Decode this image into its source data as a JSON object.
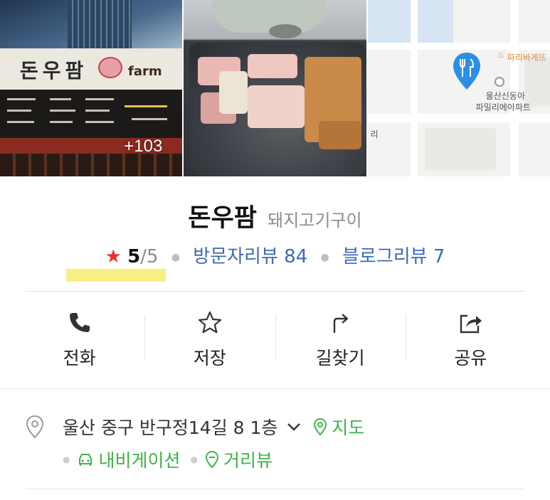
{
  "photos": {
    "storefront_sign": "돈우팜",
    "storefront_sign_suffix": "farm",
    "more_count": "+103",
    "map_labels": {
      "bakery": "파리바게뜨",
      "apartment_line1": "울산신동아",
      "apartment_line2": "파밀리에아파트",
      "edge": "리"
    }
  },
  "place": {
    "name": "돈우팜",
    "category": "돼지고기구이",
    "rating": "5",
    "rating_max": "/5",
    "visitor_reviews": "방문자리뷰 84",
    "blog_reviews": "블로그리뷰 7"
  },
  "actions": [
    {
      "label": "전화",
      "icon": "phone-icon"
    },
    {
      "label": "저장",
      "icon": "star-outline-icon"
    },
    {
      "label": "길찾기",
      "icon": "directions-icon"
    },
    {
      "label": "공유",
      "icon": "share-icon"
    }
  ],
  "address": {
    "text": "울산 중구 반구정14길 8 1층",
    "map_link": "지도",
    "navigation": "내비게이션",
    "street_view": "거리뷰"
  },
  "colors": {
    "link_blue": "#3d6ab3",
    "green": "#3db24a",
    "star_red": "#e8322f",
    "highlight": "#f6ec6e"
  }
}
